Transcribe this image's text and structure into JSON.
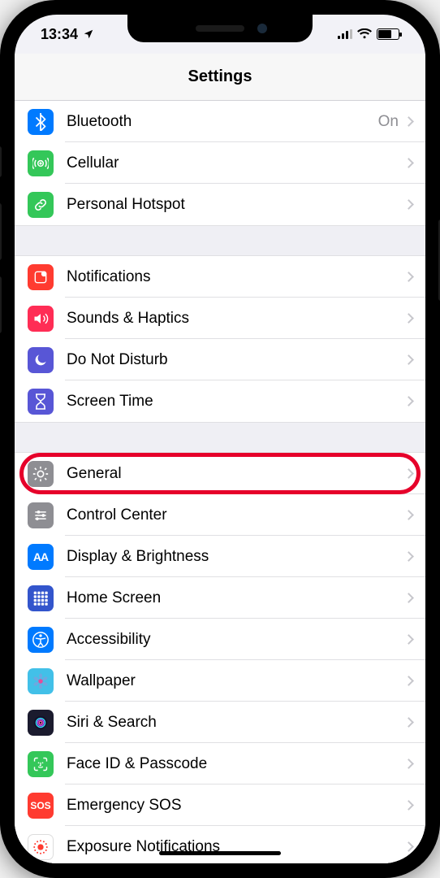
{
  "status": {
    "time": "13:34",
    "location_indicator": "location-arrow-icon"
  },
  "header": {
    "title": "Settings"
  },
  "groups": [
    {
      "rows": [
        {
          "id": "bluetooth",
          "label": "Bluetooth",
          "value": "On",
          "icon": "bluetooth-icon",
          "bg": "#007aff",
          "highlight": false
        },
        {
          "id": "cellular",
          "label": "Cellular",
          "value": "",
          "icon": "antenna-icon",
          "bg": "#34c759",
          "highlight": false
        },
        {
          "id": "hotspot",
          "label": "Personal Hotspot",
          "value": "",
          "icon": "link-icon",
          "bg": "#34c759",
          "highlight": false
        }
      ]
    },
    {
      "rows": [
        {
          "id": "notifications",
          "label": "Notifications",
          "value": "",
          "icon": "notifications-icon",
          "bg": "#ff3b30",
          "highlight": false
        },
        {
          "id": "sounds",
          "label": "Sounds & Haptics",
          "value": "",
          "icon": "speaker-icon",
          "bg": "#ff2d55",
          "highlight": false
        },
        {
          "id": "dnd",
          "label": "Do Not Disturb",
          "value": "",
          "icon": "moon-icon",
          "bg": "#5856d6",
          "highlight": false
        },
        {
          "id": "screentime",
          "label": "Screen Time",
          "value": "",
          "icon": "hourglass-icon",
          "bg": "#5856d6",
          "highlight": false
        }
      ]
    },
    {
      "rows": [
        {
          "id": "general",
          "label": "General",
          "value": "",
          "icon": "gear-icon",
          "bg": "#8e8e93",
          "highlight": true
        },
        {
          "id": "controlcenter",
          "label": "Control Center",
          "value": "",
          "icon": "sliders-icon",
          "bg": "#8e8e93",
          "highlight": false
        },
        {
          "id": "display",
          "label": "Display & Brightness",
          "value": "",
          "icon": "textsize-icon",
          "bg": "#007aff",
          "highlight": false
        },
        {
          "id": "homescreen",
          "label": "Home Screen",
          "value": "",
          "icon": "grid-icon",
          "bg": "#3355cc",
          "highlight": false
        },
        {
          "id": "accessibility",
          "label": "Accessibility",
          "value": "",
          "icon": "accessibility-icon",
          "bg": "#007aff",
          "highlight": false
        },
        {
          "id": "wallpaper",
          "label": "Wallpaper",
          "value": "",
          "icon": "flower-icon",
          "bg": "#42c0e8",
          "highlight": false
        },
        {
          "id": "siri",
          "label": "Siri & Search",
          "value": "",
          "icon": "siri-icon",
          "bg": "#1b1b2e",
          "highlight": false
        },
        {
          "id": "faceid",
          "label": "Face ID & Passcode",
          "value": "",
          "icon": "faceid-icon",
          "bg": "#34c759",
          "highlight": false
        },
        {
          "id": "sos",
          "label": "Emergency SOS",
          "value": "",
          "icon": "sos-icon",
          "bg": "#ff3b30",
          "highlight": false
        },
        {
          "id": "exposure",
          "label": "Exposure Notifications",
          "value": "",
          "icon": "exposure-icon",
          "bg": "#ffffff",
          "highlight": false
        }
      ]
    }
  ]
}
